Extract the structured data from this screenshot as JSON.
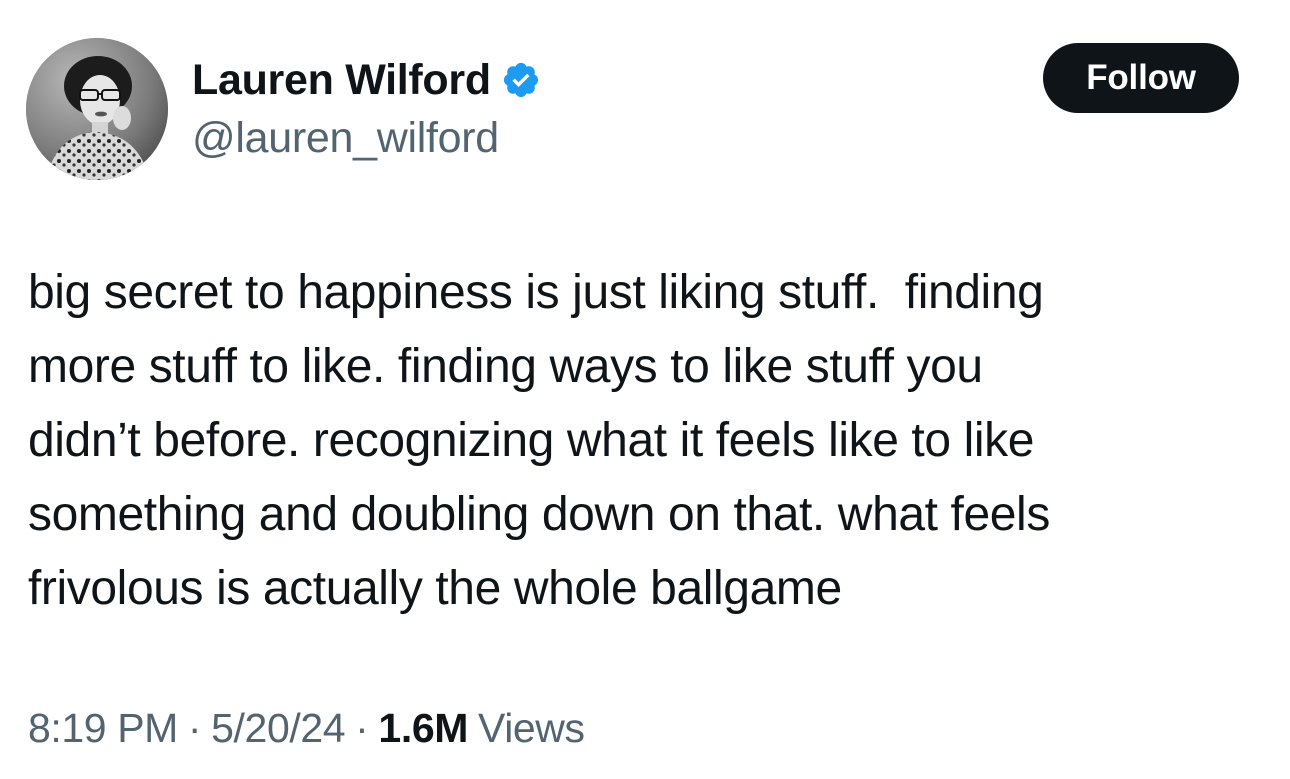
{
  "author": {
    "display_name": "Lauren Wilford",
    "handle": "@lauren_wilford",
    "verified": true,
    "verified_color": "#1d9bf0"
  },
  "actions": {
    "follow_label": "Follow"
  },
  "tweet": {
    "text": "big secret to happiness is just liking stuff.  finding\nmore stuff to like. finding ways to like stuff you\ndidn’t before. recognizing what it feels like to like\nsomething and doubling down on that. what feels\nfrivolous is actually the whole ballgame"
  },
  "meta": {
    "time": "8:19 PM",
    "separator": "·",
    "date": "5/20/24",
    "views_count": "1.6M",
    "views_label": "Views"
  },
  "icons": {
    "avatar": "profile-photo",
    "verified": "verified-badge-icon"
  }
}
